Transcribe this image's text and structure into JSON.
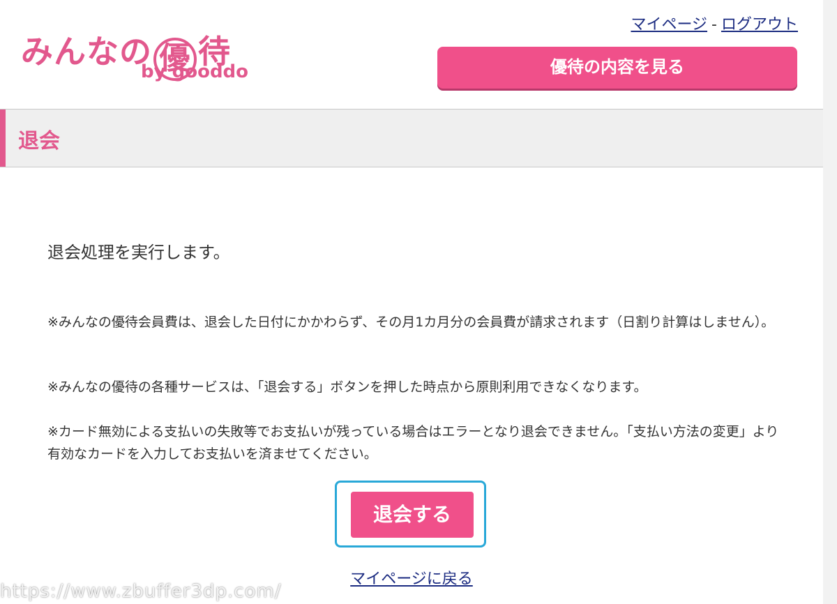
{
  "logo": {
    "text_before": "みんなの",
    "badge_char": "優",
    "text_after": "待",
    "sub": "by gooddo"
  },
  "header": {
    "mypage_link": "マイページ",
    "separator": "-",
    "logout_link": "ログアウト",
    "benefits_button": "優待の内容を見る"
  },
  "section": {
    "title": "退会"
  },
  "content": {
    "lead": "退会処理を実行します。",
    "notes": [
      "※みんなの優待会員費は、退会した日付にかかわらず、その月1カ月分の会員費が請求されます（日割り計算はしません）。",
      "※みんなの優待の各種サービスは、「退会する」ボタンを押した時点から原則利用できなくなります。",
      "※カード無効による支払いの失敗等でお支払いが残っている場合はエラーとなり退会できません。「支払い方法の変更」より有効なカードを入力してお支払いを済ませてください。"
    ],
    "withdraw_button": "退会する",
    "back_link": "マイページに戻る"
  },
  "watermark": "https://www.zbuffer3dp.com/",
  "colors": {
    "brand_pink": "#e2588d",
    "button_pink": "#f0508a",
    "link_blue": "#1a2a80",
    "highlight_blue": "#29a8d8"
  }
}
